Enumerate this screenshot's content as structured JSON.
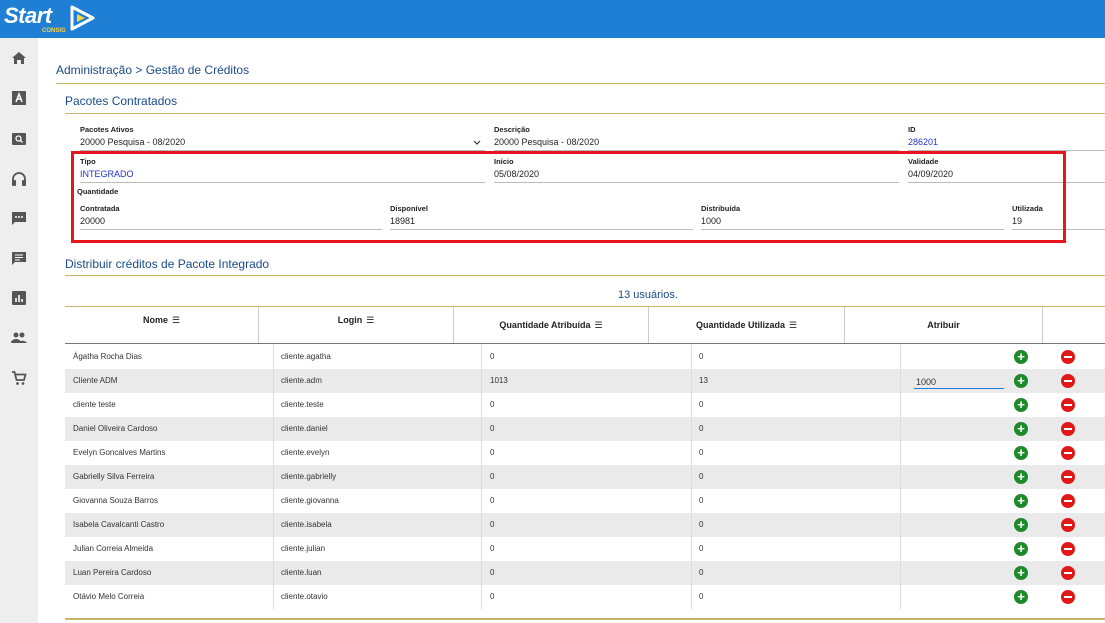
{
  "app": {
    "logo_text": "Start",
    "logo_sub": "CONSIG",
    "brand_color": "#1e7fd4"
  },
  "breadcrumb": "Administração > Gestão de Créditos",
  "pacotes": {
    "title": "Pacotes Contratados",
    "ativos_label": "Pacotes Ativos",
    "ativos_value": "20000 Pesquisa - 08/2020",
    "descricao_label": "Descrição",
    "descricao_value": "20000 Pesquisa - 08/2020",
    "id_label": "ID",
    "id_value": "286201",
    "tipo_label": "Tipo",
    "tipo_value": "INTEGRADO",
    "inicio_label": "Início",
    "inicio_value": "05/08/2020",
    "validade_label": "Validade",
    "validade_value": "04/09/2020",
    "quantidade_label": "Quantidade",
    "contratada_label": "Contratada",
    "contratada_value": "20000",
    "disponivel_label": "Disponível",
    "disponivel_value": "18981",
    "distribuida_label": "Distribuída",
    "distribuida_value": "1000",
    "utilizada_label": "Utilizada",
    "utilizada_value": "19"
  },
  "distribuir": {
    "title": "Distribuir créditos de Pacote Integrado",
    "users_count": "13 usuários.",
    "columns": {
      "nome": "Nome",
      "login": "Login",
      "qtd_atribuida": "Quantidade Atribuída",
      "qtd_utilizada": "Quantidade Utilizada",
      "atribuir": "Atribuir"
    },
    "rows": [
      {
        "nome": "Ágatha Rocha Dias",
        "login": "cliente.agatha",
        "atribuida": "0",
        "utilizada": "0",
        "atribuir": ""
      },
      {
        "nome": "Cliente ADM",
        "login": "cliente.adm",
        "atribuida": "1013",
        "utilizada": "13",
        "atribuir": "1000"
      },
      {
        "nome": "cliente teste",
        "login": "cliente.teste",
        "atribuida": "0",
        "utilizada": "0",
        "atribuir": ""
      },
      {
        "nome": "Daniel Oliveira Cardoso",
        "login": "cliente.daniel",
        "atribuida": "0",
        "utilizada": "0",
        "atribuir": ""
      },
      {
        "nome": "Evelyn Goncalves Martins",
        "login": "cliente.evelyn",
        "atribuida": "0",
        "utilizada": "0",
        "atribuir": ""
      },
      {
        "nome": "Gabrielly Silva Ferreira",
        "login": "cliente.gabrielly",
        "atribuida": "0",
        "utilizada": "0",
        "atribuir": ""
      },
      {
        "nome": "Giovanna Souza Barros",
        "login": "cliente.giovanna",
        "atribuida": "0",
        "utilizada": "0",
        "atribuir": ""
      },
      {
        "nome": "Isabela Cavalcanti Castro",
        "login": "cliente.isabela",
        "atribuida": "0",
        "utilizada": "0",
        "atribuir": ""
      },
      {
        "nome": "Julian Correia Almeida",
        "login": "cliente.julian",
        "atribuida": "0",
        "utilizada": "0",
        "atribuir": ""
      },
      {
        "nome": "Luan Pereira Cardoso",
        "login": "cliente.luan",
        "atribuida": "0",
        "utilizada": "0",
        "atribuir": ""
      },
      {
        "nome": "Otávio Melo Correia",
        "login": "cliente.otavio",
        "atribuida": "0",
        "utilizada": "0",
        "atribuir": ""
      }
    ]
  },
  "sidebar_icons": [
    "home-icon",
    "font-icon",
    "search-icon",
    "headset-icon",
    "chat-icon",
    "message-icon",
    "chart-icon",
    "people-icon",
    "cart-icon"
  ]
}
